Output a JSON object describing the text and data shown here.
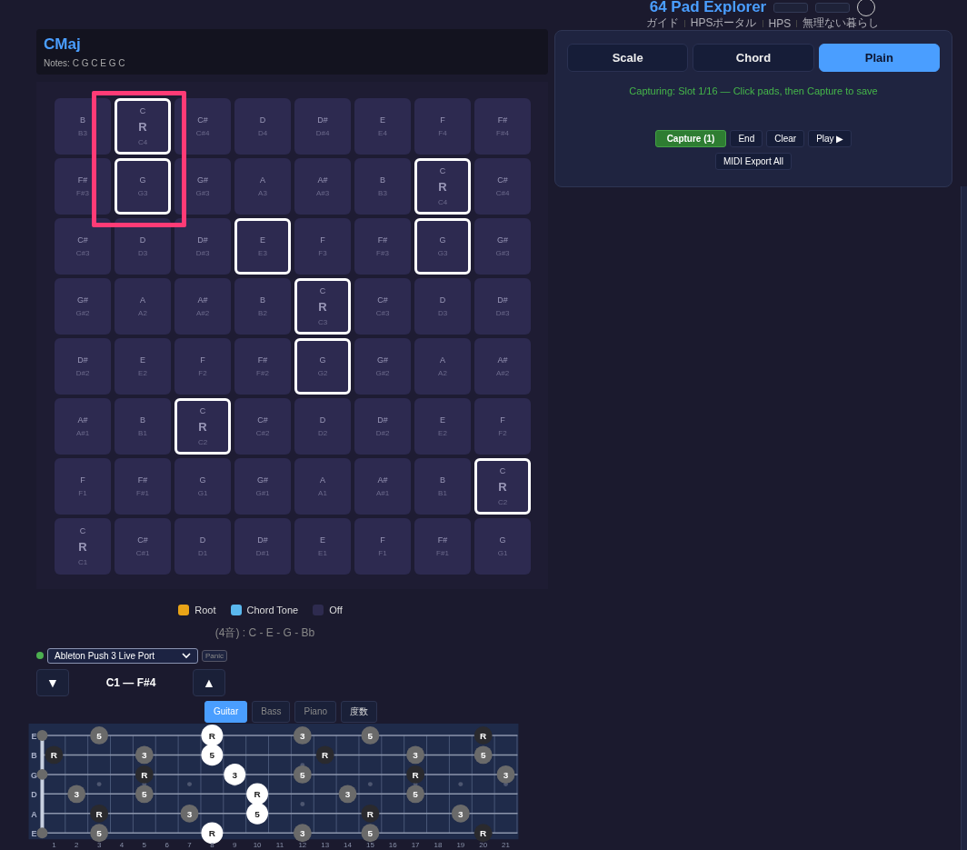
{
  "header": {
    "title": "64 Pad Explorer",
    "links": [
      "ガイド",
      "HPSポータル",
      "HPS",
      "無理ない暮らし"
    ]
  },
  "chord_box": {
    "name": "CMaj",
    "notes": "Notes: C G C E G C"
  },
  "pads": [
    [
      {
        "note": "B",
        "octave": "B3",
        "selected": false
      },
      {
        "note": "C",
        "degree": "R",
        "octave": "C4",
        "selected": true
      },
      {
        "note": "C#",
        "octave": "C#4",
        "selected": false
      },
      {
        "note": "D",
        "octave": "D4",
        "selected": false
      },
      {
        "note": "D#",
        "octave": "D#4",
        "selected": false
      },
      {
        "note": "E",
        "octave": "E4",
        "selected": false
      },
      {
        "note": "F",
        "octave": "F4",
        "selected": false
      },
      {
        "note": "F#",
        "octave": "F#4",
        "selected": false
      }
    ],
    [
      {
        "note": "F#",
        "octave": "F#3",
        "selected": false
      },
      {
        "note": "G",
        "octave": "G3",
        "selected": true
      },
      {
        "note": "G#",
        "octave": "G#3",
        "selected": false
      },
      {
        "note": "A",
        "octave": "A3",
        "selected": false
      },
      {
        "note": "A#",
        "octave": "A#3",
        "selected": false
      },
      {
        "note": "B",
        "octave": "B3",
        "selected": false
      },
      {
        "note": "C",
        "degree": "R",
        "octave": "C4",
        "selected": true
      },
      {
        "note": "C#",
        "octave": "C#4",
        "selected": false
      }
    ],
    [
      {
        "note": "C#",
        "octave": "C#3",
        "selected": false
      },
      {
        "note": "D",
        "octave": "D3",
        "selected": false
      },
      {
        "note": "D#",
        "octave": "D#3",
        "selected": false
      },
      {
        "note": "E",
        "octave": "E3",
        "selected": true
      },
      {
        "note": "F",
        "octave": "F3",
        "selected": false
      },
      {
        "note": "F#",
        "octave": "F#3",
        "selected": false
      },
      {
        "note": "G",
        "octave": "G3",
        "selected": true
      },
      {
        "note": "G#",
        "octave": "G#3",
        "selected": false
      }
    ],
    [
      {
        "note": "G#",
        "octave": "G#2",
        "selected": false
      },
      {
        "note": "A",
        "octave": "A2",
        "selected": false
      },
      {
        "note": "A#",
        "octave": "A#2",
        "selected": false
      },
      {
        "note": "B",
        "octave": "B2",
        "selected": false
      },
      {
        "note": "C",
        "degree": "R",
        "octave": "C3",
        "selected": true
      },
      {
        "note": "C#",
        "octave": "C#3",
        "selected": false
      },
      {
        "note": "D",
        "octave": "D3",
        "selected": false
      },
      {
        "note": "D#",
        "octave": "D#3",
        "selected": false
      }
    ],
    [
      {
        "note": "D#",
        "octave": "D#2",
        "selected": false
      },
      {
        "note": "E",
        "octave": "E2",
        "selected": false
      },
      {
        "note": "F",
        "octave": "F2",
        "selected": false
      },
      {
        "note": "F#",
        "octave": "F#2",
        "selected": false
      },
      {
        "note": "G",
        "octave": "G2",
        "selected": true
      },
      {
        "note": "G#",
        "octave": "G#2",
        "selected": false
      },
      {
        "note": "A",
        "octave": "A2",
        "selected": false
      },
      {
        "note": "A#",
        "octave": "A#2",
        "selected": false
      }
    ],
    [
      {
        "note": "A#",
        "octave": "A#1",
        "selected": false
      },
      {
        "note": "B",
        "octave": "B1",
        "selected": false
      },
      {
        "note": "C",
        "degree": "R",
        "octave": "C2",
        "selected": true
      },
      {
        "note": "C#",
        "octave": "C#2",
        "selected": false
      },
      {
        "note": "D",
        "octave": "D2",
        "selected": false
      },
      {
        "note": "D#",
        "octave": "D#2",
        "selected": false
      },
      {
        "note": "E",
        "octave": "E2",
        "selected": false
      },
      {
        "note": "F",
        "octave": "F2",
        "selected": false
      }
    ],
    [
      {
        "note": "F",
        "octave": "F1",
        "selected": false
      },
      {
        "note": "F#",
        "octave": "F#1",
        "selected": false
      },
      {
        "note": "G",
        "octave": "G1",
        "selected": false
      },
      {
        "note": "G#",
        "octave": "G#1",
        "selected": false
      },
      {
        "note": "A",
        "octave": "A1",
        "selected": false
      },
      {
        "note": "A#",
        "octave": "A#1",
        "selected": false
      },
      {
        "note": "B",
        "octave": "B1",
        "selected": false
      },
      {
        "note": "C",
        "degree": "R",
        "octave": "C2",
        "selected": true
      }
    ],
    [
      {
        "note": "C",
        "degree": "R",
        "octave": "C1",
        "selected": false
      },
      {
        "note": "C#",
        "octave": "C#1",
        "selected": false
      },
      {
        "note": "D",
        "octave": "D1",
        "selected": false
      },
      {
        "note": "D#",
        "octave": "D#1",
        "selected": false
      },
      {
        "note": "E",
        "octave": "E1",
        "selected": false
      },
      {
        "note": "F",
        "octave": "F1",
        "selected": false
      },
      {
        "note": "F#",
        "octave": "F#1",
        "selected": false
      },
      {
        "note": "G",
        "octave": "G1",
        "selected": false
      }
    ]
  ],
  "legend": [
    {
      "label": "Root",
      "color": "#e8a317"
    },
    {
      "label": "Chord Tone",
      "color": "#5ab8ee"
    },
    {
      "label": "Off",
      "color": "#2e2b4f"
    }
  ],
  "chord_formula": "(4音) : C - E - G - Bb",
  "midi": {
    "connected": true,
    "port": "Ableton Push 3 Live Port",
    "panic": "Panic"
  },
  "range": {
    "down": "▼",
    "label": "C1 — F#4",
    "up": "▲"
  },
  "instrument_tabs": [
    {
      "label": "Guitar",
      "selected": true
    },
    {
      "label": "Bass",
      "selected": false
    },
    {
      "label": "Piano",
      "selected": false
    },
    {
      "label": "度数",
      "selected": false
    }
  ],
  "fretboard": {
    "fret_numbers": [
      "1",
      "2",
      "3",
      "4",
      "5",
      "6",
      "7",
      "8",
      "9",
      "10",
      "11",
      "12",
      "13",
      "14",
      "15",
      "16",
      "17",
      "18",
      "19",
      "20",
      "21"
    ],
    "strings": [
      {
        "name": "E",
        "cells": [
          {
            "kind": "open"
          },
          null,
          null,
          {
            "label": "5",
            "kind": "tone"
          },
          null,
          null,
          null,
          null,
          {
            "label": "R",
            "kind": "active"
          },
          null,
          null,
          null,
          {
            "label": "3",
            "kind": "tone"
          },
          null,
          null,
          {
            "label": "5",
            "kind": "tone"
          },
          null,
          null,
          null,
          null,
          {
            "label": "R",
            "kind": "root"
          },
          null
        ]
      },
      {
        "name": "B",
        "cells": [
          null,
          {
            "label": "R",
            "kind": "root"
          },
          null,
          null,
          null,
          {
            "label": "3",
            "kind": "tone"
          },
          null,
          null,
          {
            "label": "5",
            "kind": "active"
          },
          null,
          null,
          null,
          null,
          {
            "label": "R",
            "kind": "root"
          },
          null,
          null,
          null,
          {
            "label": "3",
            "kind": "tone"
          },
          null,
          null,
          {
            "label": "5",
            "kind": "tone"
          },
          null
        ]
      },
      {
        "name": "G",
        "cells": [
          {
            "kind": "open"
          },
          null,
          null,
          null,
          null,
          {
            "label": "R",
            "kind": "root"
          },
          null,
          null,
          null,
          {
            "label": "3",
            "kind": "active"
          },
          null,
          null,
          {
            "label": "5",
            "kind": "tone"
          },
          null,
          null,
          null,
          null,
          {
            "label": "R",
            "kind": "root"
          },
          null,
          null,
          null,
          {
            "label": "3",
            "kind": "tone"
          }
        ]
      },
      {
        "name": "D",
        "cells": [
          null,
          null,
          {
            "label": "3",
            "kind": "tone"
          },
          null,
          null,
          {
            "label": "5",
            "kind": "tone"
          },
          null,
          null,
          null,
          null,
          {
            "label": "R",
            "kind": "active"
          },
          null,
          null,
          null,
          {
            "label": "3",
            "kind": "tone"
          },
          null,
          null,
          {
            "label": "5",
            "kind": "tone"
          },
          null,
          null,
          null,
          null
        ]
      },
      {
        "name": "A",
        "cells": [
          null,
          null,
          null,
          {
            "label": "R",
            "kind": "root"
          },
          null,
          null,
          null,
          {
            "label": "3",
            "kind": "tone"
          },
          null,
          null,
          {
            "label": "5",
            "kind": "active"
          },
          null,
          null,
          null,
          null,
          {
            "label": "R",
            "kind": "root"
          },
          null,
          null,
          null,
          {
            "label": "3",
            "kind": "tone"
          },
          null,
          null
        ]
      },
      {
        "name": "E",
        "cells": [
          {
            "kind": "open"
          },
          null,
          null,
          {
            "label": "5",
            "kind": "tone"
          },
          null,
          null,
          null,
          null,
          {
            "label": "R",
            "kind": "active"
          },
          null,
          null,
          null,
          {
            "label": "3",
            "kind": "tone"
          },
          null,
          null,
          {
            "label": "5",
            "kind": "tone"
          },
          null,
          null,
          null,
          null,
          {
            "label": "R",
            "kind": "root"
          },
          null
        ]
      }
    ]
  },
  "mode_tabs": [
    {
      "label": "Scale",
      "selected": false
    },
    {
      "label": "Chord",
      "selected": false
    },
    {
      "label": "Plain",
      "selected": true
    }
  ],
  "capture_status": "Capturing: Slot 1/16 — Click pads, then Capture to save",
  "capture_buttons": [
    {
      "label": "Capture (1)",
      "kind": "primary"
    },
    {
      "label": "End",
      "kind": "plain"
    },
    {
      "label": "Clear",
      "kind": "plain"
    },
    {
      "label": "Play ▶",
      "kind": "plain"
    }
  ],
  "export_button": "MIDI Export All"
}
